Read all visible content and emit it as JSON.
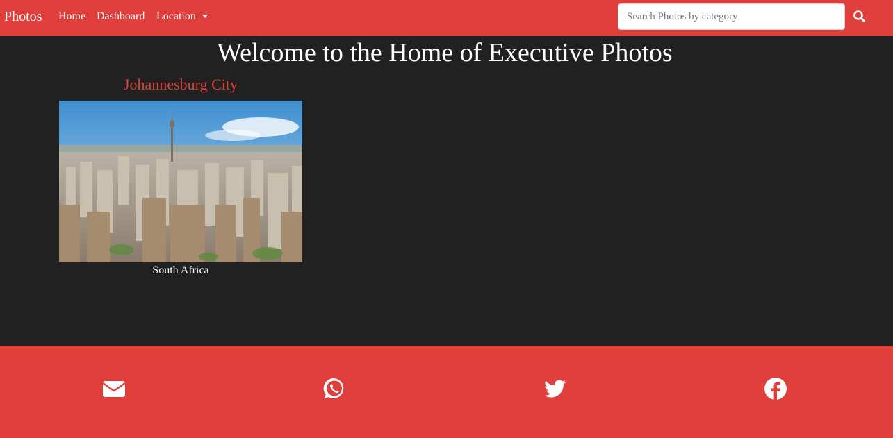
{
  "navbar": {
    "brand": "Photos",
    "links": [
      "Home",
      "Dashboard",
      "Location"
    ],
    "search": {
      "placeholder": "Search Photos by category",
      "icon": "search-icon"
    }
  },
  "main": {
    "title": "Welcome to the Home of Executive Photos",
    "cards": [
      {
        "title": "Johannesburg City",
        "caption": "South Africa",
        "image": "johannesburg-city-skyline-photo"
      }
    ]
  },
  "footer": {
    "icons": [
      "envelope-icon",
      "whatsapp-icon",
      "twitter-icon",
      "facebook-icon"
    ]
  },
  "colors": {
    "accent": "#e03e3b",
    "background": "#212121",
    "text": "#ffffff"
  }
}
